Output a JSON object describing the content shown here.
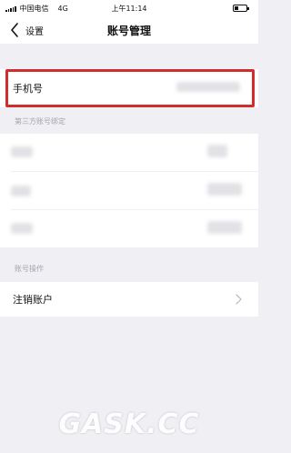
{
  "status_bar": {
    "carrier": "中国电信",
    "network": "4G",
    "time": "上午11:14"
  },
  "nav": {
    "back_label": "设置",
    "title": "账号管理"
  },
  "phone_row": {
    "label": "手机号"
  },
  "third_party": {
    "header": "第三方账号绑定"
  },
  "account_ops": {
    "header": "账号操作",
    "cancel_label": "注销账户"
  },
  "watermark": "GASK.CC",
  "colors": {
    "highlight": "#d02d2d",
    "background": "#efeff4"
  },
  "icons": [
    "chevron-left-icon",
    "chevron-right-icon",
    "signal-icon",
    "battery-icon"
  ]
}
